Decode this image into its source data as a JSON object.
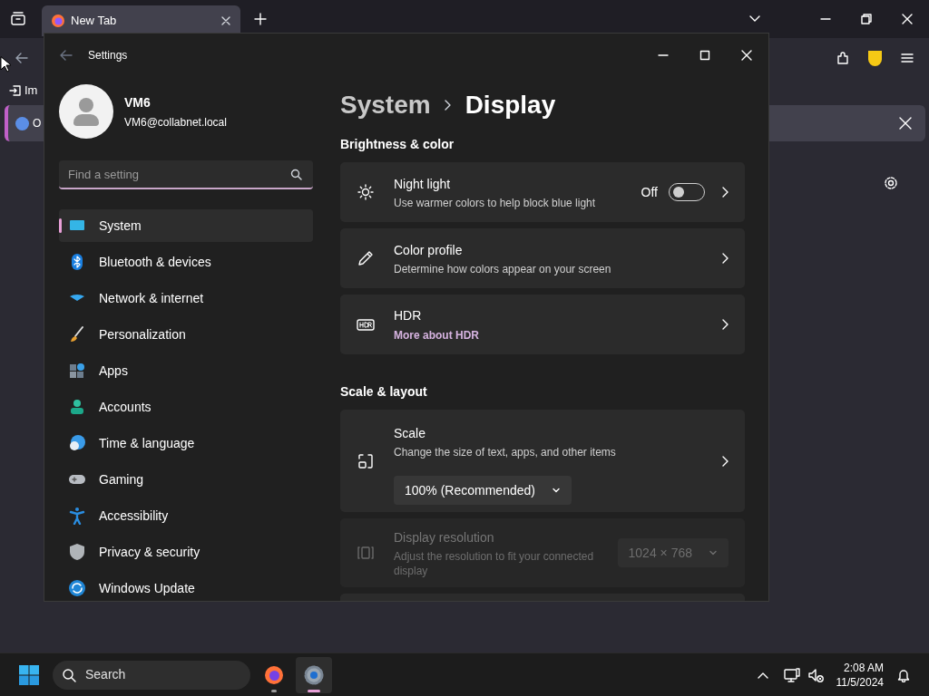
{
  "browser": {
    "tabs": [
      {
        "title": "New Tab",
        "selected": true
      }
    ],
    "bookmark_cut": "Im",
    "notice_cut": "O"
  },
  "settings": {
    "window_title": "Settings",
    "user": {
      "name": "VM6",
      "email": "VM6@collabnet.local"
    },
    "search": {
      "placeholder": "Find a setting"
    },
    "nav": [
      {
        "label": "System",
        "selected": true
      },
      {
        "label": "Bluetooth & devices",
        "selected": false
      },
      {
        "label": "Network & internet",
        "selected": false
      },
      {
        "label": "Personalization",
        "selected": false
      },
      {
        "label": "Apps",
        "selected": false
      },
      {
        "label": "Accounts",
        "selected": false
      },
      {
        "label": "Time & language",
        "selected": false
      },
      {
        "label": "Gaming",
        "selected": false
      },
      {
        "label": "Accessibility",
        "selected": false
      },
      {
        "label": "Privacy & security",
        "selected": false
      },
      {
        "label": "Windows Update",
        "selected": false
      }
    ],
    "breadcrumb": [
      "System",
      "Display"
    ],
    "sections": [
      {
        "title": "Brightness & color",
        "cards": [
          {
            "kind": "toggle",
            "title": "Night light",
            "subtitle": "Use warmer colors to help block blue light",
            "state_label": "Off",
            "on": false,
            "disabled": false
          },
          {
            "kind": "link",
            "title": "Color profile",
            "subtitle": "Determine how colors appear on your screen",
            "disabled": false
          },
          {
            "kind": "link",
            "title": "HDR",
            "subtitle_link": "More about HDR",
            "disabled": false
          }
        ]
      },
      {
        "title": "Scale & layout",
        "cards": [
          {
            "kind": "dropdown_link",
            "title": "Scale",
            "subtitle": "Change the size of text, apps, and other items",
            "value": "100% (Recommended)",
            "disabled": false
          },
          {
            "kind": "dropdown",
            "title": "Display resolution",
            "subtitle": "Adjust the resolution to fit your connected display",
            "value": "1024 × 768",
            "disabled": true
          }
        ]
      }
    ]
  },
  "taskbar": {
    "search": "Search",
    "apps": [
      {
        "kind": "firefox",
        "selected": false
      },
      {
        "kind": "settings",
        "selected": true
      }
    ],
    "time": "2:08 AM",
    "date": "11/5/2024"
  }
}
